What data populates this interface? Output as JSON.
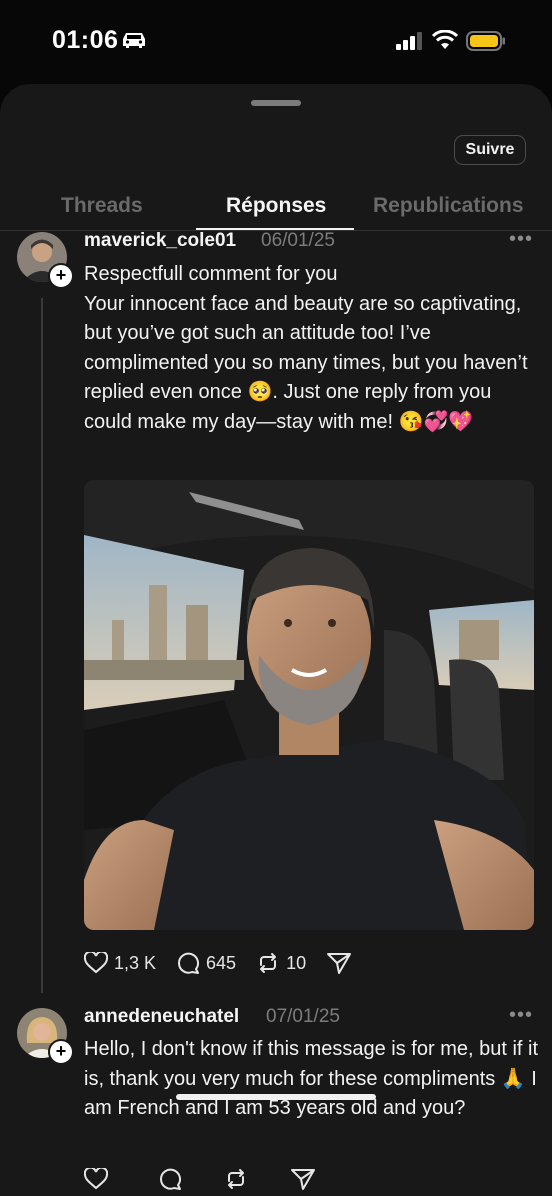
{
  "status_bar": {
    "time": "01:06"
  },
  "sheet": {
    "follow_label": "Suivre"
  },
  "tabs": [
    {
      "label": "Threads",
      "active": false
    },
    {
      "label": "Réponses",
      "active": true
    },
    {
      "label": "Republications",
      "active": false
    }
  ],
  "posts": [
    {
      "username": "maverick_cole01",
      "date": "06/01/25",
      "title": "Respectfull comment for you",
      "body": "Your innocent face and beauty are so captivating, but you’ve got such an attitude too! I’ve complimented you so many times, but you haven’t replied even once 🥺. Just one reply from you could make my day—stay with me! 😘💞💖",
      "likes": "1,3 K",
      "comments": "645",
      "reposts": "10"
    },
    {
      "username": "annedeneuchatel",
      "date": "07/01/25",
      "body": "Hello, I don't know if this message is for me, but if it is, thank you very much for these compliments 🙏 I am French and I am 53 years old and you?",
      "likes": "",
      "comments": ""
    }
  ],
  "colors": {
    "background": "#181818",
    "text": "#f2f2f2",
    "muted": "#7c7c7c"
  },
  "icons": [
    "car-icon",
    "signal-icon",
    "wifi-icon",
    "battery-icon",
    "plus-icon",
    "more-icon",
    "heart-icon",
    "comment-icon",
    "repost-icon",
    "send-icon"
  ]
}
